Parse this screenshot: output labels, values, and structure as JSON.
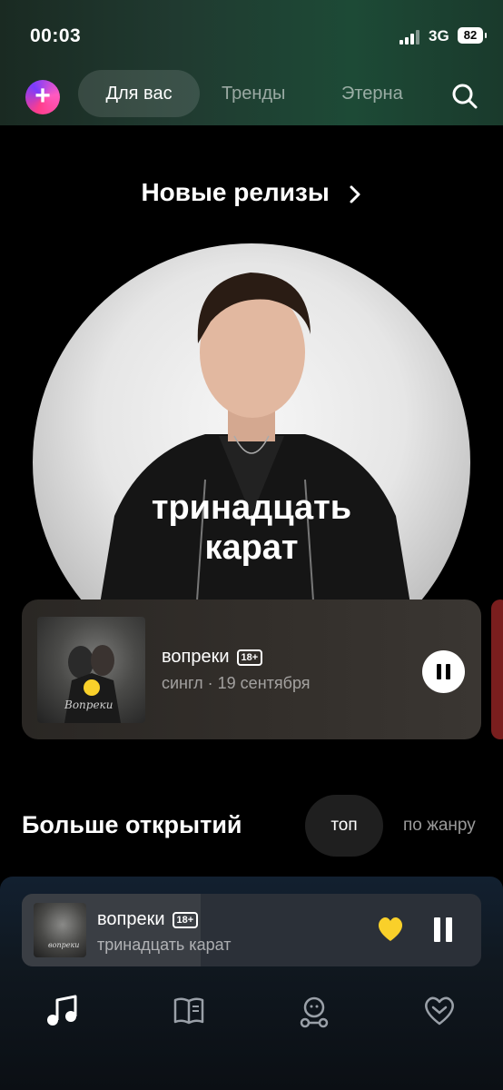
{
  "status_bar": {
    "time": "00:03",
    "network": "3G",
    "battery": "82"
  },
  "nav": {
    "tabs": [
      {
        "label": "Для вас",
        "active": true
      },
      {
        "label": "Тренды",
        "active": false
      },
      {
        "label": "Этерна",
        "active": false
      }
    ],
    "plus_icon": "plus-logo-icon",
    "search_icon": "search-icon"
  },
  "new_releases": {
    "title": "Новые релизы",
    "hero_text_line1": "тринадцать",
    "hero_text_line2": "карат",
    "card": {
      "title": "вопреки",
      "badge": "18+",
      "subtitle": "сингл · 19 сентября",
      "cover_text": "Вопреки"
    }
  },
  "discover": {
    "title": "Больше открытий",
    "chips": [
      "топ",
      "по жанру"
    ]
  },
  "mini_player": {
    "title": "вопреки",
    "badge": "18+",
    "artist": "тринадцать карат",
    "cover_text": "вопреки",
    "progress": 0.39
  },
  "colors": {
    "accent_yellow": "#f9d02a",
    "background": "#000000"
  },
  "tabbar": {
    "icons": [
      "music-note-icon",
      "book-icon",
      "kids-icon",
      "heart-icon"
    ]
  }
}
